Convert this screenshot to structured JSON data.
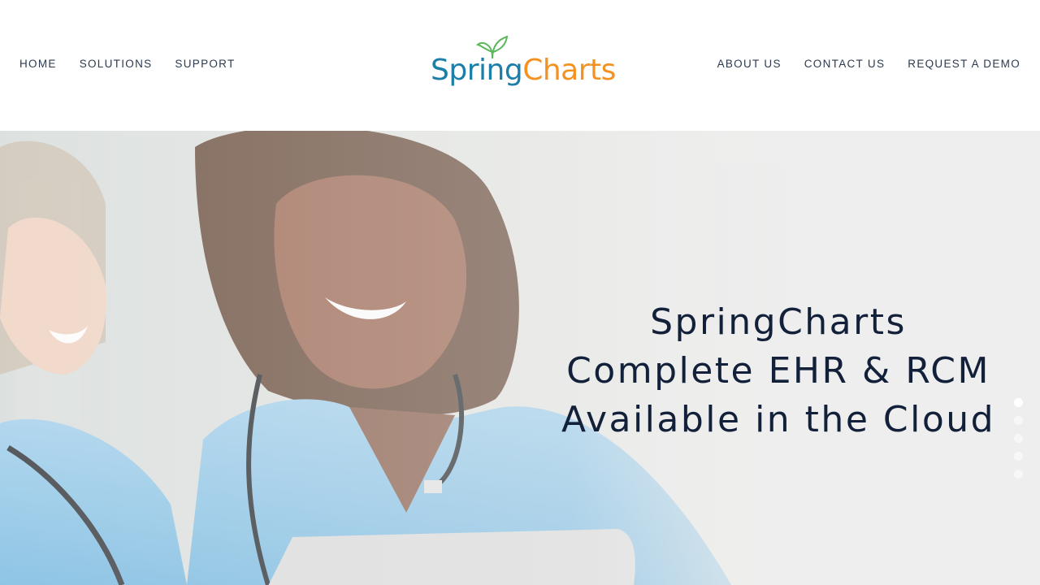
{
  "nav": {
    "left": [
      {
        "label": "HOME"
      },
      {
        "label": "SOLUTIONS"
      },
      {
        "label": "SUPPORT"
      }
    ],
    "right": [
      {
        "label": "ABOUT US"
      },
      {
        "label": "CONTACT US"
      },
      {
        "label": "REQUEST A DEMO"
      }
    ]
  },
  "logo": {
    "part1": "Spring",
    "part2": "Charts",
    "colors": {
      "spring": "#1c7fa8",
      "charts": "#f39221",
      "leaf": "#5bb85a"
    }
  },
  "hero": {
    "title": "SpringCharts Complete EHR & RCM Available in the Cloud",
    "slide_count": 5,
    "active_slide": 1
  },
  "colors": {
    "nav_text": "#2b3a4e",
    "title_text": "#12203a",
    "scrub_blue": "#8ec6e6"
  }
}
